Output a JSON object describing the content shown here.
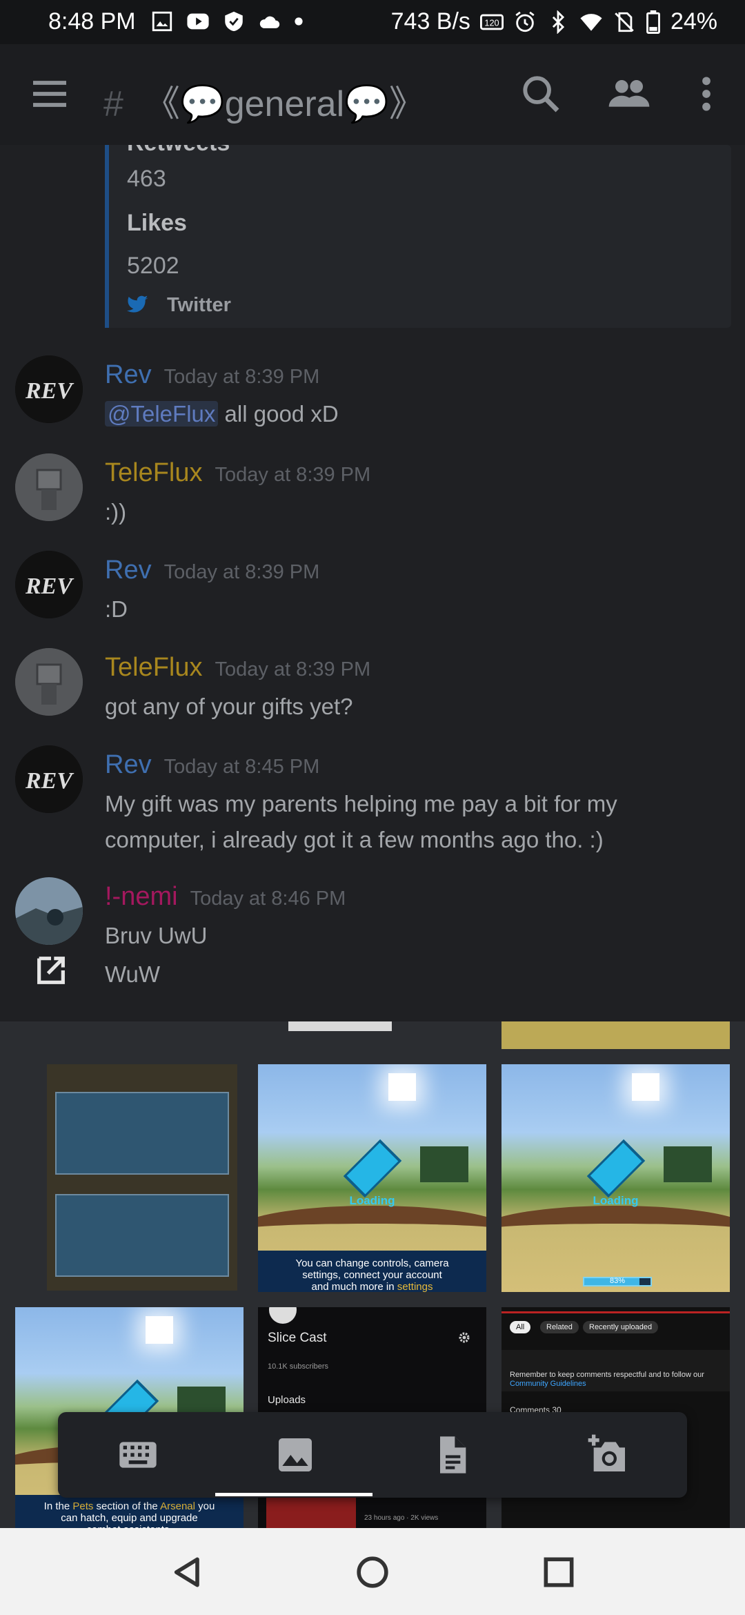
{
  "status_bar": {
    "time": "8:48 PM",
    "net_speed": "743 B/s",
    "battery": "24%",
    "icons": [
      "image-icon",
      "youtube-icon",
      "shield-icon",
      "cloud-icon",
      "dot-icon",
      "hd-icon",
      "alarm-icon",
      "bluetooth-icon",
      "wifi-icon",
      "no-sim-icon",
      "battery-icon"
    ]
  },
  "header": {
    "channel_prefix": "《",
    "channel_emoji": "💬",
    "channel_title": "general",
    "channel_suffix": "》",
    "icons": [
      "menu-icon",
      "hash-icon",
      "search-icon",
      "members-icon",
      "more-vert-icon"
    ]
  },
  "embed": {
    "partial_label": "Retweets",
    "retweets_value": "463",
    "likes_label": "Likes",
    "likes_value": "5202",
    "footer": "Twitter"
  },
  "messages": [
    {
      "author": "Rev",
      "color": "#3f6fb0",
      "timestamp": "Today at 8:39 PM",
      "mention": "@TeleFlux",
      "text": " all good xD"
    },
    {
      "author": "TeleFlux",
      "color": "#a8871e",
      "timestamp": "Today at 8:39 PM",
      "text": ":))"
    },
    {
      "author": "Rev",
      "color": "#3f6fb0",
      "timestamp": "Today at 8:39 PM",
      "text": ":D"
    },
    {
      "author": "TeleFlux",
      "color": "#a8871e",
      "timestamp": "Today at 8:39 PM",
      "text": "got any of your gifts yet?"
    },
    {
      "author": "Rev",
      "color": "#3f6fb0",
      "timestamp": "Today at 8:45 PM",
      "text_line1": "My gift was my parents helping me pay a bit for my",
      "text_line2": "computer, i already got it a few months ago tho. :)"
    },
    {
      "author": "!-nemi",
      "color": "#a4185e",
      "timestamp": "Today at 8:46 PM",
      "text_line1": "Bruv UwU",
      "text_line2": "WuW"
    }
  ],
  "gallery": {
    "loading_text": "Loading",
    "caption_1": "You can change controls, camera settings, connect your account and much more in",
    "caption_1_hl": "settings",
    "progress": "83%",
    "caption_2_pre": "In the",
    "caption_2_hl1": "Pets",
    "caption_2_mid": "section of the",
    "caption_2_hl2": "Arsenal",
    "caption_2_post": "you can hatch, equip and upgrade combat assistants.",
    "yt_channel": "Slice Cast",
    "yt_subs": "10.1K subscribers",
    "yt_uploads": "Uploads",
    "yt_meta": "23 hours ago · 2K views",
    "chip_all": "All",
    "chip_related": "Related",
    "chip_recent": "Recently uploaded",
    "yt_comment_notice": "Remember to keep comments respectful and to follow our",
    "yt_guidelines": "Community Guidelines",
    "yt_comments": "Comments 30"
  },
  "colors": {
    "background": "#1f2023",
    "accent_blue": "#3f6fb0",
    "accent_gold": "#a8871e",
    "accent_pink": "#a4185e"
  }
}
